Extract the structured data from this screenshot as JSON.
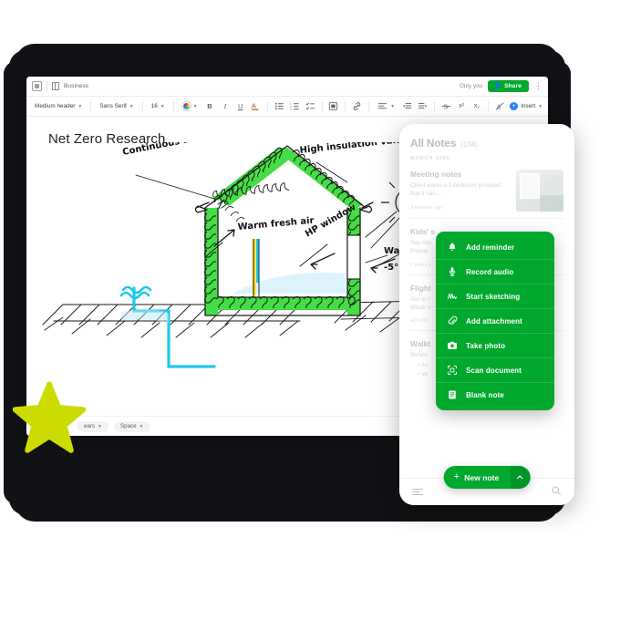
{
  "tablet": {
    "header": {
      "app_icon": "grid-icon",
      "breadcrumb_icon": "notebook-icon",
      "breadcrumb": "Business",
      "sharing_status": "Only you",
      "share_label": "Share",
      "share_icon": "person-add-icon",
      "more_icon": "kebab-menu-icon"
    },
    "toolbar": {
      "style_dropdown": "Medium header",
      "font_dropdown": "Sans Serif",
      "size_dropdown": "16",
      "color_picker": "color-wheel-icon",
      "bold": "B",
      "italic": "I",
      "underline": "U",
      "text_color": "A",
      "bulleted_list": "bulleted-list-icon",
      "numbered_list": "numbered-list-icon",
      "checklist": "checklist-icon",
      "code_block": "code-block-icon",
      "link": "link-icon",
      "align": "align-icon",
      "indent_decrease": "outdent-icon",
      "indent_increase": "indent-icon",
      "strikethrough": "strikethrough-icon",
      "superscript": "x²",
      "subscript": "x₂",
      "clear_format": "clear-format-icon",
      "insert_label": "Insert",
      "insert_icon": "plus-circle-icon"
    },
    "document": {
      "title": "Net Zero Research",
      "annotations": [
        "Continuous air barrier",
        "High insulation value",
        "Warm fresh air",
        "HP window",
        "Wat",
        "-5°"
      ]
    },
    "footer": {
      "pill_one": "ears",
      "pill_two": "Space"
    }
  },
  "phone": {
    "heading": "All Notes",
    "count": "(104)",
    "month": "MARCH 2020",
    "notes": [
      {
        "title": "Meeting notes",
        "snippet": "Client wants a 2-bedroom provided that it has...",
        "time": "3 minutes ago",
        "has_thumb": true
      },
      {
        "title": "Kids' s",
        "snippet": "Ray has\nPickup",
        "time": "2 hours a",
        "has_thumb": false
      },
      {
        "title": "Flight",
        "snippet": "Get to t\nMicah s",
        "time": "4/30/20",
        "has_thumb": false
      },
      {
        "title": "Walkt",
        "snippet": "Before",
        "bullets": "• As\n• Ve",
        "time": "",
        "has_thumb": false
      }
    ],
    "flyout": [
      {
        "label": "Add reminder",
        "icon": "bell-icon"
      },
      {
        "label": "Record audio",
        "icon": "microphone-icon"
      },
      {
        "label": "Start sketching",
        "icon": "scribble-icon"
      },
      {
        "label": "Add attachment",
        "icon": "paperclip-icon"
      },
      {
        "label": "Take photo",
        "icon": "camera-icon"
      },
      {
        "label": "Scan document",
        "icon": "scan-icon"
      },
      {
        "label": "Blank note",
        "icon": "note-icon"
      }
    ],
    "bottom": {
      "menu_icon": "hamburger-icon",
      "new_note_label": "New note",
      "new_note_plus": "+",
      "new_note_caret": "chevron-up-icon",
      "search_icon": "search-icon"
    }
  },
  "decor": {
    "star_icon": "star-shape"
  },
  "colors": {
    "brand_green": "#00a82d",
    "accent_blue": "#2b7fff",
    "star_yellow": "#cddc00",
    "sketch_green": "#3ed93e",
    "sketch_cyan": "#2ad4f0",
    "sketch_yellow": "#ffd400",
    "ink": "#111111"
  }
}
